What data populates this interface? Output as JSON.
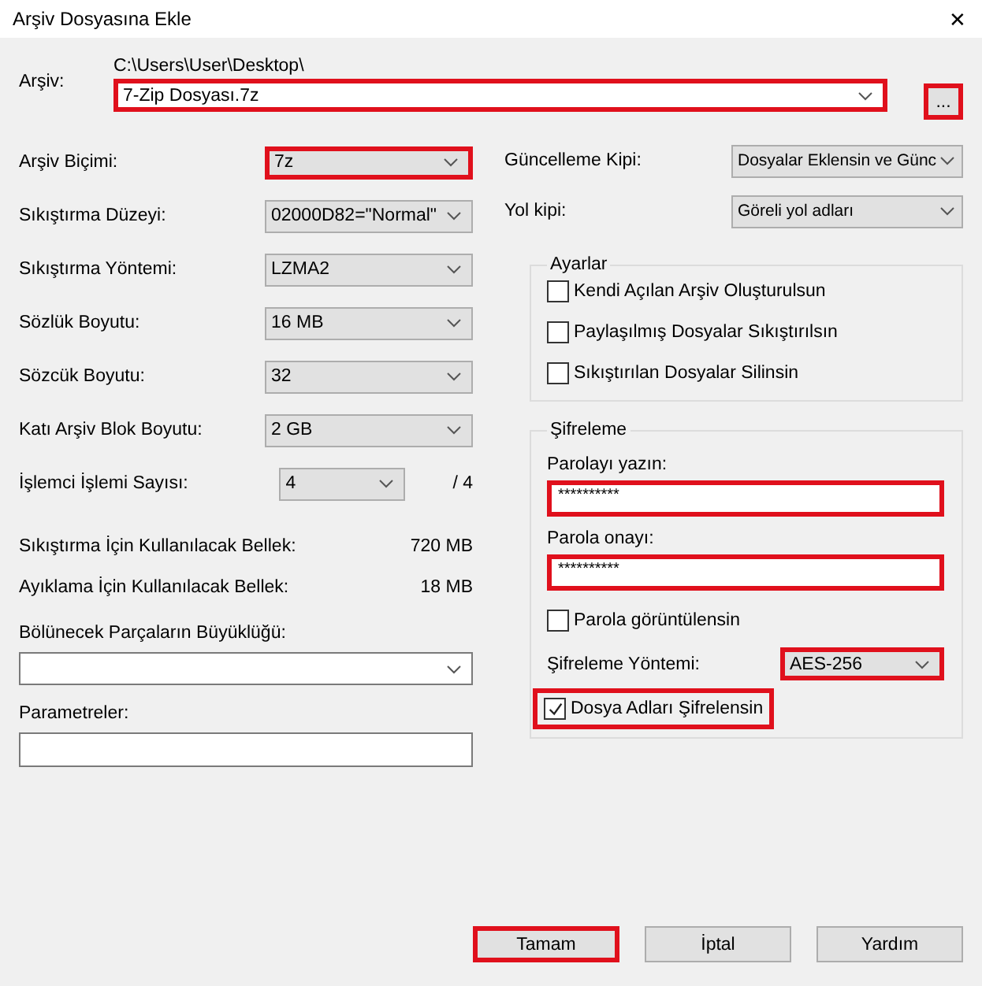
{
  "window": {
    "title": "Arşiv Dosyasına Ekle",
    "close": "✕"
  },
  "archive": {
    "label": "Arşiv:",
    "path": "C:\\Users\\User\\Desktop\\",
    "value": "7-Zip Dosyası.7z",
    "highlighted": true,
    "browse": {
      "label": "...",
      "highlighted": true
    }
  },
  "left_fields": [
    {
      "kind": "combo",
      "label": "Arşiv Biçimi:",
      "value": "7z",
      "highlighted": true
    },
    {
      "kind": "combo",
      "label": "Sıkıştırma Düzeyi:",
      "value": "02000D82=\"Normal\"",
      "highlighted": false
    },
    {
      "kind": "combo",
      "label": "Sıkıştırma Yöntemi:",
      "value": "LZMA2",
      "highlighted": false
    },
    {
      "kind": "combo",
      "label": "Sözlük Boyutu:",
      "value": "16 MB",
      "highlighted": false
    },
    {
      "kind": "combo",
      "label": "Sözcük Boyutu:",
      "value": "32",
      "highlighted": false
    },
    {
      "kind": "combo",
      "label": "Katı Arşiv Blok Boyutu:",
      "value": "2 GB",
      "highlighted": false
    },
    {
      "kind": "threads",
      "label": "İşlemci İşlemi Sayısı:",
      "value": "4",
      "suffix": "/ 4",
      "highlighted": false
    }
  ],
  "memory": [
    {
      "label": "Sıkıştırma İçin Kullanılacak Bellek:",
      "value": "720 MB"
    },
    {
      "label": "Ayıklama İçin Kullanılacak Bellek:",
      "value": "18 MB"
    }
  ],
  "split": {
    "label": "Bölünecek Parçaların Büyüklüğü:"
  },
  "parameters": {
    "label": "Parametreler:"
  },
  "right_fields": [
    {
      "label": "Güncelleme Kipi:",
      "value": "Dosyalar Eklensin ve Günc"
    },
    {
      "label": "Yol kipi:",
      "value": "Göreli yol adları"
    }
  ],
  "settings": {
    "title": "Ayarlar",
    "options": [
      {
        "label": "Kendi Açılan Arşiv Oluşturulsun",
        "checked": false
      },
      {
        "label": "Paylaşılmış Dosyalar Sıkıştırılsın",
        "checked": false
      },
      {
        "label": "Sıkıştırılan Dosyalar Silinsin",
        "checked": false
      }
    ]
  },
  "encryption": {
    "title": "Şifreleme",
    "password_label": "Parolayı yazın:",
    "password": "**********",
    "password_highlighted": true,
    "confirm_label": "Parola onayı:",
    "confirm": "**********",
    "confirm_highlighted": true,
    "show_password": {
      "label": "Parola görüntülensin",
      "checked": false
    },
    "method_label": "Şifreleme Yöntemi:",
    "method": "AES-256",
    "method_highlighted": true,
    "encrypt_names": {
      "label": "Dosya Adları Şifrelensin",
      "checked": true,
      "highlighted": true
    }
  },
  "buttons": [
    {
      "label": "Tamam",
      "highlighted": true
    },
    {
      "label": "İptal",
      "highlighted": false
    },
    {
      "label": "Yardım",
      "highlighted": false
    }
  ]
}
